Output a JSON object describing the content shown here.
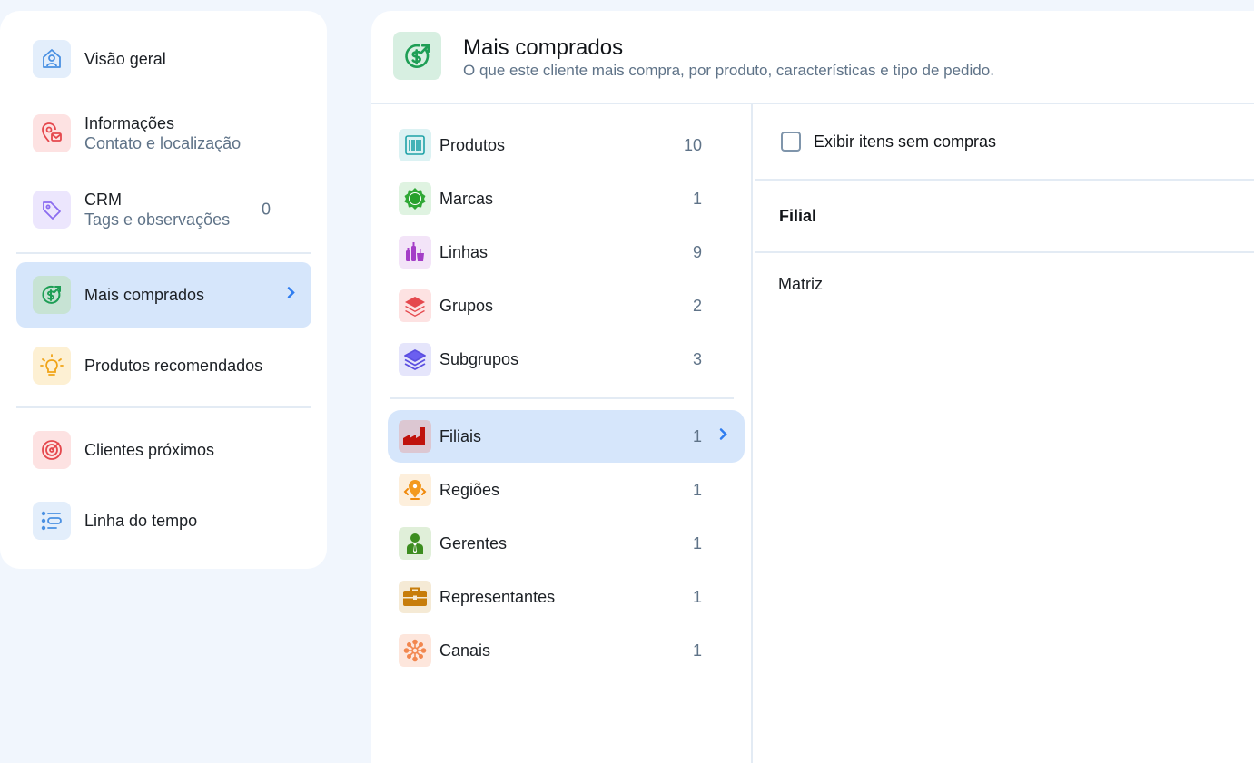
{
  "sidebar": {
    "items": [
      {
        "label": "Visão geral",
        "icon": "user-home-icon"
      },
      {
        "label": "Informações",
        "sub": "Contato e localização",
        "icon": "location-mail-icon"
      },
      {
        "label": "CRM",
        "sub": "Tags e observações",
        "count": "0",
        "icon": "tag-icon"
      },
      {
        "label": "Mais comprados",
        "icon": "dollar-trend-icon",
        "active": true
      },
      {
        "label": "Produtos recomendados",
        "icon": "lightbulb-icon"
      },
      {
        "label": "Clientes próximos",
        "icon": "target-icon"
      },
      {
        "label": "Linha do tempo",
        "icon": "timeline-icon"
      }
    ]
  },
  "header": {
    "title": "Mais comprados",
    "subtitle": "O que este cliente mais compra, por produto, características e tipo de pedido."
  },
  "categories": [
    {
      "label": "Produtos",
      "count": "10",
      "icon": "barcode-icon"
    },
    {
      "label": "Marcas",
      "count": "1",
      "icon": "badge-icon"
    },
    {
      "label": "Linhas",
      "count": "9",
      "icon": "bottles-icon"
    },
    {
      "label": "Grupos",
      "count": "2",
      "icon": "layers-icon"
    },
    {
      "label": "Subgrupos",
      "count": "3",
      "icon": "stack-icon"
    },
    {
      "label": "Filiais",
      "count": "1",
      "icon": "factory-icon",
      "active": true
    },
    {
      "label": "Regiões",
      "count": "1",
      "icon": "region-pin-icon"
    },
    {
      "label": "Gerentes",
      "count": "1",
      "icon": "manager-icon"
    },
    {
      "label": "Representantes",
      "count": "1",
      "icon": "briefcase-icon"
    },
    {
      "label": "Canais",
      "count": "1",
      "icon": "network-icon"
    }
  ],
  "detail": {
    "show_empty_label": "Exibir itens sem compras",
    "column_header": "Filial",
    "rows": [
      "Matriz"
    ]
  },
  "colors": {
    "active_bg": "#d6e6fb",
    "accent": "#2f7df0",
    "muted_text": "#5f7388"
  }
}
